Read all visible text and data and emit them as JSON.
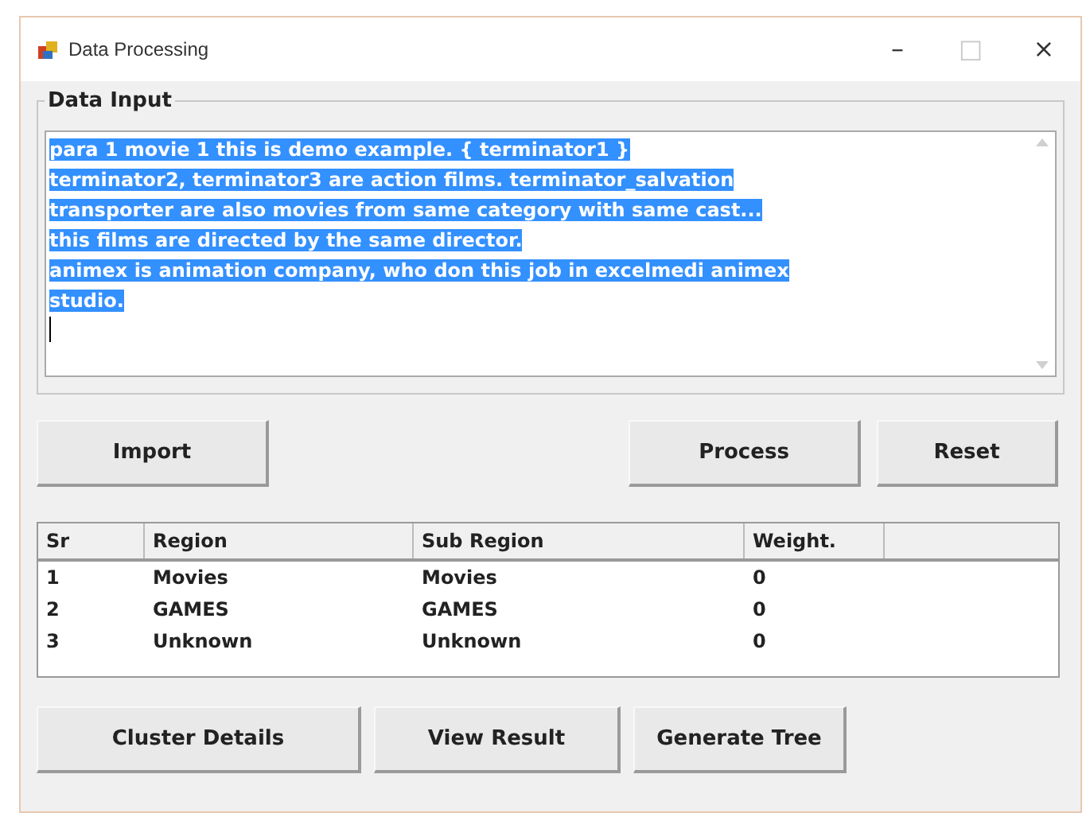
{
  "window": {
    "title": "Data Processing",
    "controls": [
      "–",
      "□",
      "×"
    ]
  },
  "data_input": {
    "label": "Data Input",
    "selected": true,
    "lines": [
      "para 1 movie 1 this is demo example. { terminator1 }",
      "terminator2, terminator3 are action films. terminator_salvation",
      "transporter are also movies from same category with same cast...",
      "this films are directed by the same director.",
      "animex is animation company, who don this job in excelmedi animex",
      "studio."
    ]
  },
  "top_buttons": [
    "Import",
    "Process",
    "Reset"
  ],
  "table": {
    "columns": [
      "Sr",
      "Region",
      "Sub Region",
      "Weight."
    ],
    "rows": [
      [
        "1",
        "Movies",
        "Movies",
        "0"
      ],
      [
        "2",
        "GAMES",
        "GAMES",
        "0"
      ],
      [
        "3",
        "Unknown",
        "Unknown",
        "0"
      ]
    ]
  },
  "bottom_buttons": [
    "Cluster Details",
    "View Result",
    "Generate Tree"
  ]
}
